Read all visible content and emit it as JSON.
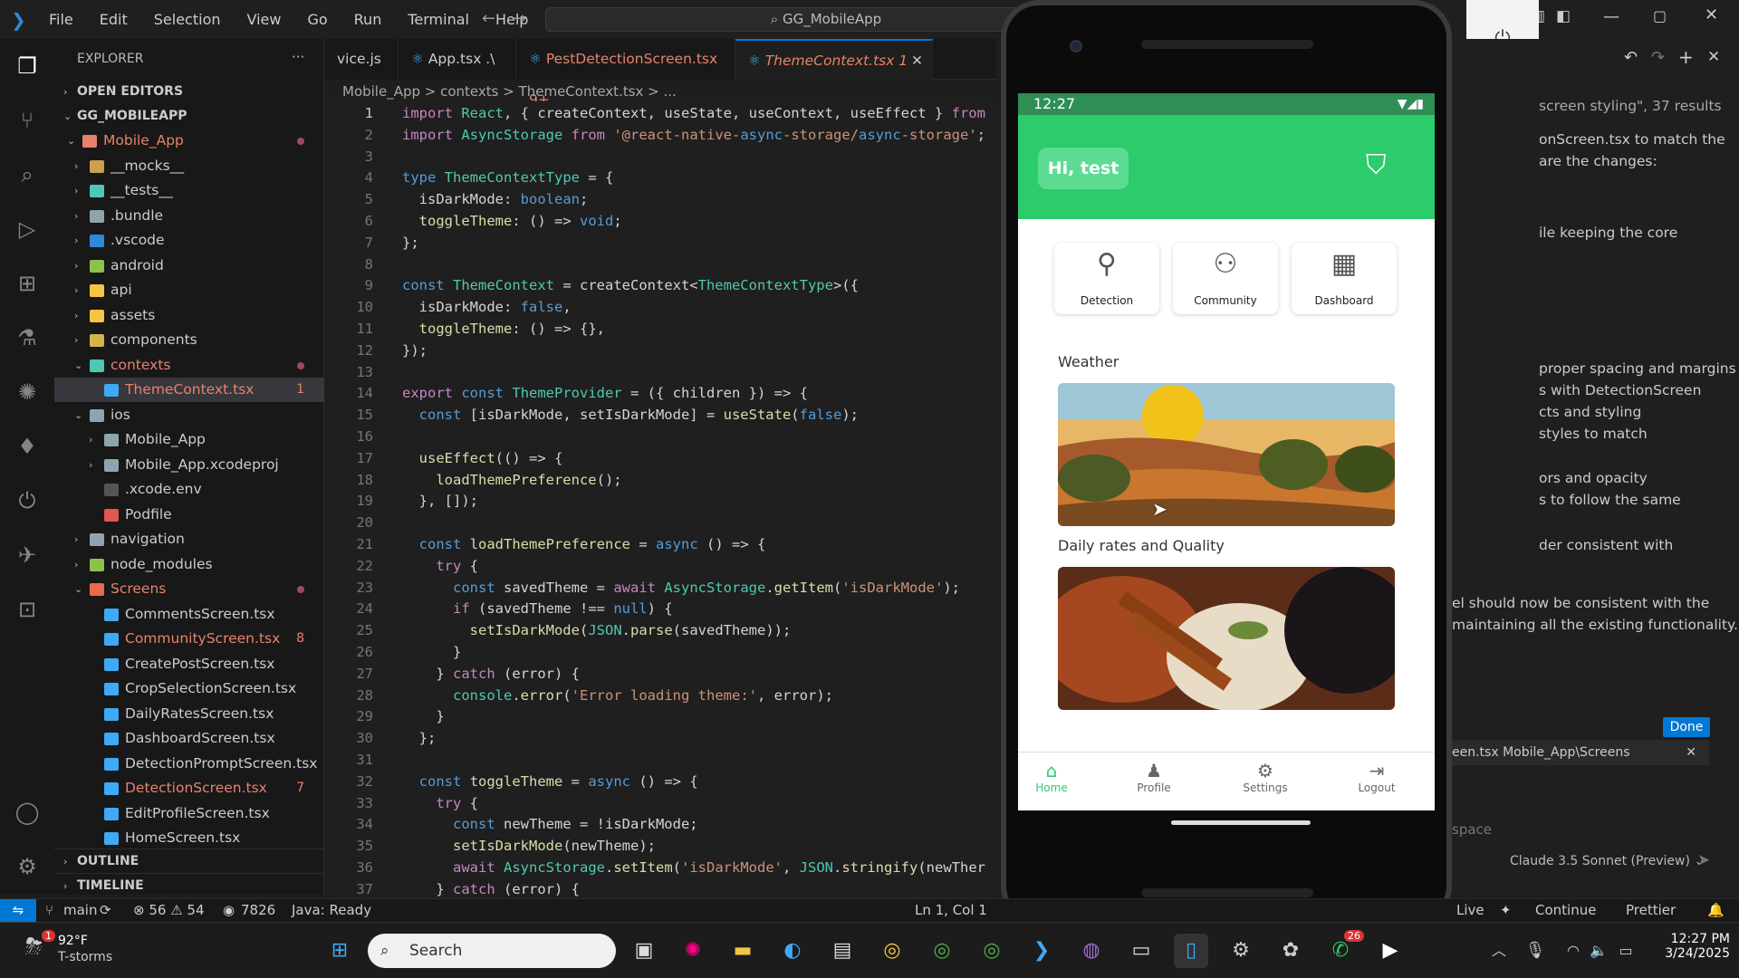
{
  "titlebar": {
    "menu": [
      "File",
      "Edit",
      "Selection",
      "View",
      "Go",
      "Run",
      "Terminal",
      "Help"
    ],
    "search": "GG_MobileApp"
  },
  "explorer": {
    "title": "EXPLORER",
    "more": "···",
    "sections": {
      "open_editors": "OPEN EDITORS",
      "root": "GG_MOBILEAPP",
      "outline": "OUTLINE",
      "timeline": "TIMELINE"
    },
    "items": [
      {
        "label": "Mobile_App",
        "chev": "⌄",
        "color": "#e8826a",
        "icon": "#e8826a"
      },
      {
        "label": "__mocks__",
        "chev": "›",
        "color": "#ccc",
        "icon": "#c9a04b"
      },
      {
        "label": "__tests__",
        "chev": "›",
        "color": "#ccc",
        "icon": "#4ec9b0"
      },
      {
        "label": ".bundle",
        "chev": "›",
        "color": "#ccc",
        "icon": "#90a4ae"
      },
      {
        "label": ".vscode",
        "chev": "›",
        "color": "#ccc",
        "icon": "#2f88d8"
      },
      {
        "label": "android",
        "chev": "›",
        "color": "#ccc",
        "icon": "#8bc34a"
      },
      {
        "label": "api",
        "chev": "›",
        "color": "#ccc",
        "icon": "#f4c542"
      },
      {
        "label": "assets",
        "chev": "›",
        "color": "#ccc",
        "icon": "#f4c542"
      },
      {
        "label": "components",
        "chev": "›",
        "color": "#ccc",
        "icon": "#d4b44a"
      },
      {
        "label": "contexts",
        "chev": "⌄",
        "color": "#e8826a",
        "icon": "#4ec9b0"
      },
      {
        "label": "ThemeContext.tsx",
        "chev": "",
        "color": "#e8826a",
        "icon": "#3fa9f5",
        "badge": "1"
      },
      {
        "label": "ios",
        "chev": "⌄",
        "color": "#ccc",
        "icon": "#90a4ae"
      },
      {
        "label": "Mobile_App",
        "chev": "›",
        "color": "#ccc",
        "icon": "#90a4ae"
      },
      {
        "label": "Mobile_App.xcodeproj",
        "chev": "›",
        "color": "#ccc",
        "icon": "#90a4ae"
      },
      {
        "label": ".xcode.env",
        "chev": "",
        "color": "#ccc",
        "icon": "#555"
      },
      {
        "label": "Podfile",
        "chev": "",
        "color": "#ccc",
        "icon": "#e05555"
      },
      {
        "label": "navigation",
        "chev": "›",
        "color": "#ccc",
        "icon": "#90a4ae"
      },
      {
        "label": "node_modules",
        "chev": "›",
        "color": "#ccc",
        "icon": "#8bc34a"
      },
      {
        "label": "Screens",
        "chev": "⌄",
        "color": "#e8826a",
        "icon": "#e86a4a"
      },
      {
        "label": "CommentsScreen.tsx",
        "chev": "",
        "color": "#ccc",
        "icon": "#3fa9f5"
      },
      {
        "label": "CommunityScreen.tsx",
        "chev": "",
        "color": "#e8826a",
        "icon": "#3fa9f5",
        "badge": "8"
      },
      {
        "label": "CreatePostScreen.tsx",
        "chev": "",
        "color": "#ccc",
        "icon": "#3fa9f5"
      },
      {
        "label": "CropSelectionScreen.tsx",
        "chev": "",
        "color": "#ccc",
        "icon": "#3fa9f5"
      },
      {
        "label": "DailyRatesScreen.tsx",
        "chev": "",
        "color": "#ccc",
        "icon": "#3fa9f5"
      },
      {
        "label": "DashboardScreen.tsx",
        "chev": "",
        "color": "#ccc",
        "icon": "#3fa9f5"
      },
      {
        "label": "DetectionPromptScreen.tsx",
        "chev": "",
        "color": "#ccc",
        "icon": "#3fa9f5"
      },
      {
        "label": "DetectionScreen.tsx",
        "chev": "",
        "color": "#e8826a",
        "icon": "#3fa9f5",
        "badge": "7"
      },
      {
        "label": "EditProfileScreen.tsx",
        "chev": "",
        "color": "#ccc",
        "icon": "#3fa9f5"
      },
      {
        "label": "HomeScreen.tsx",
        "chev": "",
        "color": "#ccc",
        "icon": "#3fa9f5"
      }
    ]
  },
  "tabs": [
    {
      "label": "vice.js",
      "color": "#ccc"
    },
    {
      "label": "App.tsx .\\",
      "color": "#ccc"
    },
    {
      "label": "PestDetectionScreen.tsx 9+",
      "color": "#e8826a"
    },
    {
      "label": "ThemeContext.tsx 1",
      "color": "#e8826a",
      "active": true
    }
  ],
  "breadcrumb": "Mobile_App > contexts > ThemeContext.tsx > ...",
  "code": [
    "import React, { createContext, useState, useContext, useEffect } from",
    "import AsyncStorage from '@react-native-async-storage/async-storage';",
    "",
    "type ThemeContextType = {",
    "  isDarkMode: boolean;",
    "  toggleTheme: () => void;",
    "};",
    "",
    "const ThemeContext = createContext<ThemeContextType>({",
    "  isDarkMode: false,",
    "  toggleTheme: () => {},",
    "});",
    "",
    "export const ThemeProvider = ({ children }) => {",
    "  const [isDarkMode, setIsDarkMode] = useState(false);",
    "",
    "  useEffect(() => {",
    "    loadThemePreference();",
    "  }, []);",
    "",
    "  const loadThemePreference = async () => {",
    "    try {",
    "      const savedTheme = await AsyncStorage.getItem('isDarkMode');",
    "      if (savedTheme !== null) {",
    "        setIsDarkMode(JSON.parse(savedTheme));",
    "      }",
    "    } catch (error) {",
    "      console.error('Error loading theme:', error);",
    "    }",
    "  };",
    "",
    "  const toggleTheme = async () => {",
    "    try {",
    "      const newTheme = !isDarkMode;",
    "      setIsDarkMode(newTheme);",
    "      await AsyncStorage.setItem('isDarkMode', JSON.stringify(newTher",
    "    } catch (error) {"
  ],
  "phone": {
    "time": "12:27",
    "greeting": "Hi, test",
    "cards": [
      "Detection",
      "Community",
      "Dashboard"
    ],
    "weather_label": "Weather",
    "rates_label": "Daily rates and Quality",
    "tabbar": [
      {
        "label": "Home",
        "icon": "home-icon",
        "active": true
      },
      {
        "label": "Profile",
        "icon": "profile-icon"
      },
      {
        "label": "Settings",
        "icon": "settings-icon"
      },
      {
        "label": "Logout",
        "icon": "logout-icon"
      }
    ]
  },
  "chat": {
    "lines": [
      "screen styling\", 37 results",
      "onScreen.tsx to match the",
      "are the changes:",
      "ile keeping the core",
      "proper spacing and margins",
      "s with DetectionScreen",
      "cts and styling",
      "styles to match",
      "ors and opacity",
      "s to follow the same",
      "der consistent with",
      "el should now be consistent with the",
      "maintaining all the existing functionality."
    ],
    "done": "Done",
    "file": "een.tsx  Mobile_App\\Screens",
    "placeholder": "space",
    "model": "Claude 3.5 Sonnet (Preview) ⌄"
  },
  "status": {
    "branch": "main",
    "errors": "⊗ 56  ⚠ 54",
    "ports": "7826",
    "java": "Java: Ready",
    "position": "Ln 1, Col 1",
    "live": "Live",
    "continue": "Continue",
    "prettier": "Prettier"
  },
  "taskbar": {
    "temp": "92°F",
    "weather": "T-storms",
    "search": "Search",
    "time": "12:27 PM",
    "date": "3/24/2025",
    "whatsapp_badge": "26",
    "weather_badge": "1"
  }
}
